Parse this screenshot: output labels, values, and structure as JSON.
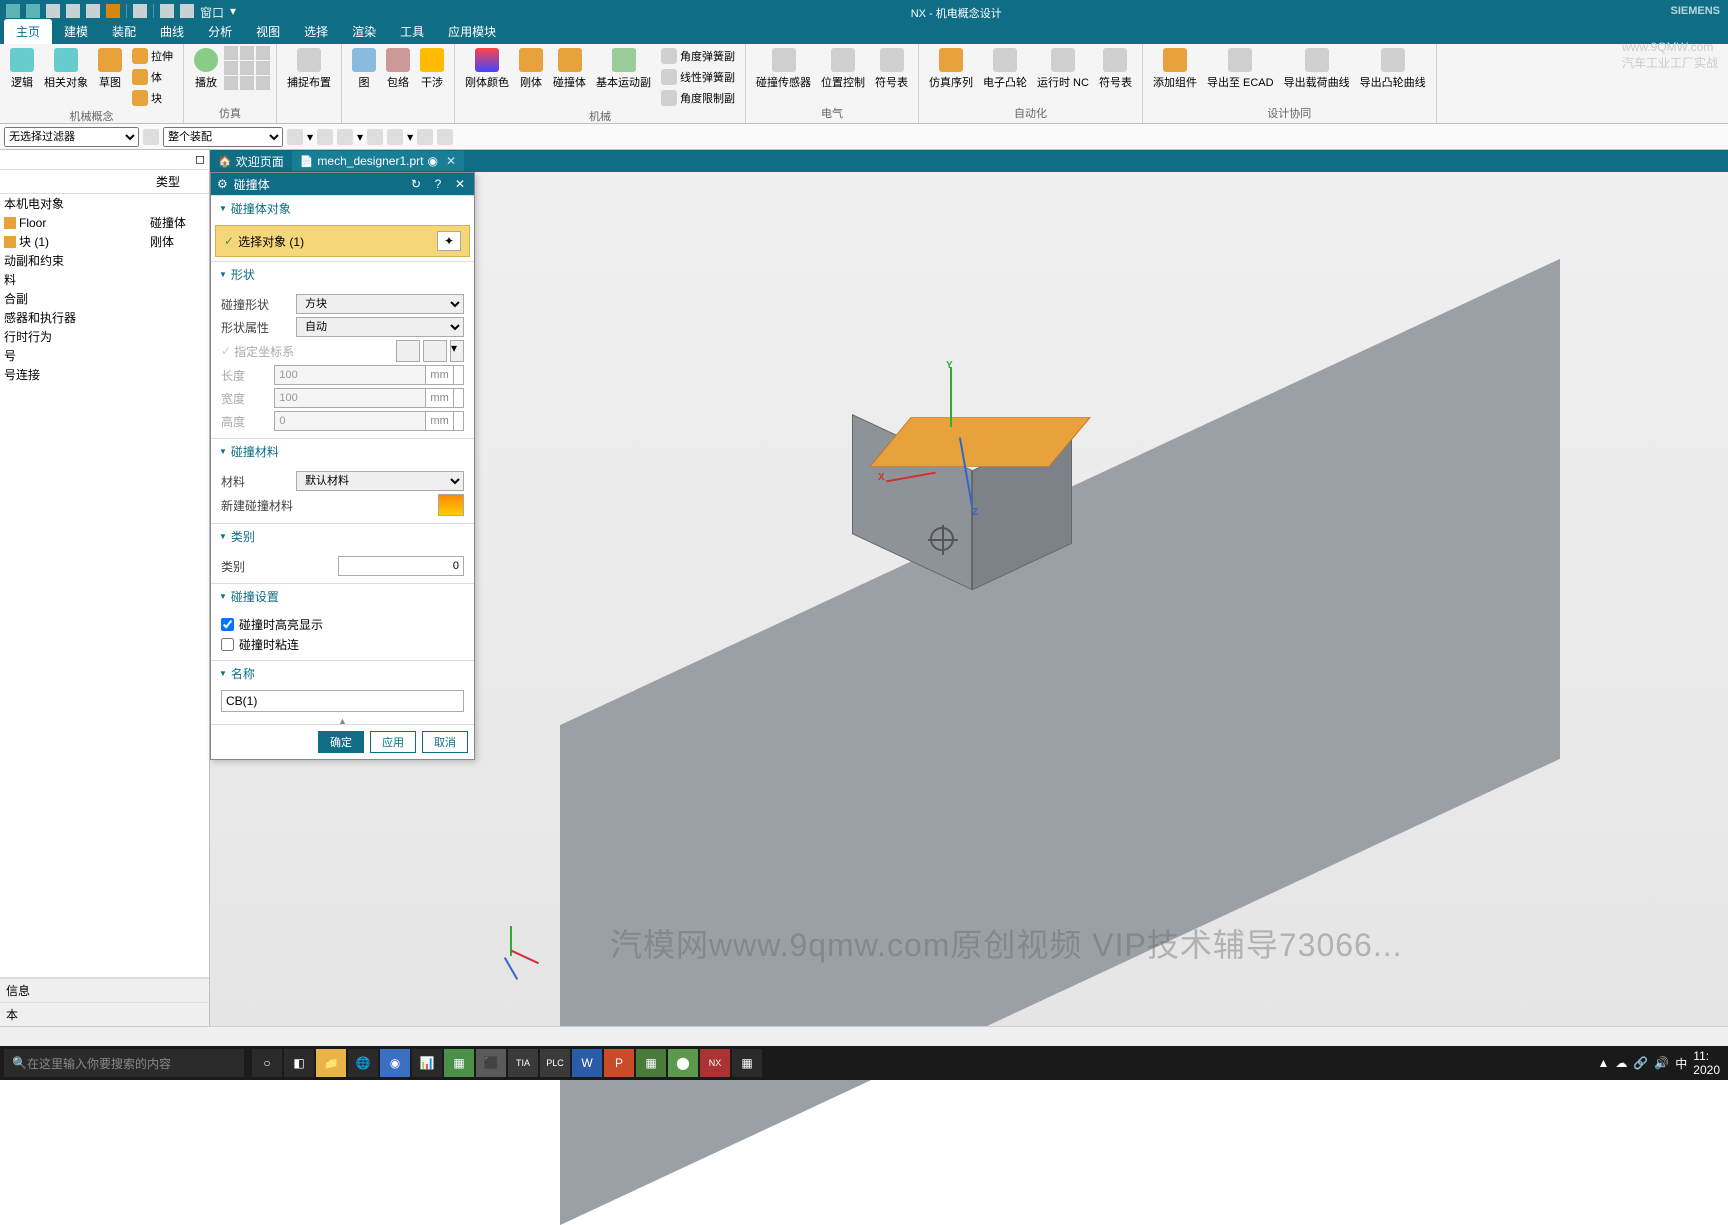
{
  "app_title": "NX - 机电概念设计",
  "brand": "SIEMENS",
  "watermark_url": "www.9QMW.com",
  "watermark_text": "汽车工业工厂实战",
  "footer_watermark": "汽模网www.9qmw.com原创视频 VIP技术辅导73066...",
  "menu": {
    "tabs": [
      "主页",
      "建模",
      "装配",
      "曲线",
      "分析",
      "视图",
      "选择",
      "渲染",
      "工具",
      "应用模块"
    ],
    "active": 0
  },
  "quick_access": {
    "window_label": "窗口"
  },
  "ribbon_groups": [
    {
      "name": "机械概念",
      "buttons": [
        "逻辑",
        "相关对象",
        "草图",
        ""
      ],
      "stack": [
        "拉伸",
        "体",
        "块"
      ]
    },
    {
      "name": "仿真",
      "buttons": [
        "播放"
      ],
      "small": [
        "",
        "",
        "",
        "",
        "",
        ""
      ]
    },
    {
      "name": "",
      "buttons": [
        "捕捉布置"
      ]
    },
    {
      "name": "",
      "buttons": [
        "图",
        "包络",
        "干涉"
      ]
    },
    {
      "name": "机械",
      "buttons": [
        "刚体颜色",
        "刚体",
        "碰撞体",
        "基本运动副"
      ],
      "stack": [
        "角度弹簧副",
        "线性弹簧副",
        "角度限制副"
      ]
    },
    {
      "name": "电气",
      "buttons": [
        "碰撞传感器",
        "位置控制",
        "符号表"
      ]
    },
    {
      "name": "自动化",
      "buttons": [
        "仿真序列",
        "电子凸轮",
        "运行时 NC",
        "符号表"
      ]
    },
    {
      "name": "设计协同",
      "buttons": [
        "添加组件",
        "导出至 ECAD",
        "导出载荷曲线",
        "导出凸轮曲线"
      ]
    }
  ],
  "filter": {
    "none": "无选择过滤器",
    "assembly": "整个装配"
  },
  "file_tabs": {
    "welcome": "欢迎页面",
    "file": "mech_designer1.prt"
  },
  "tree": {
    "cols": [
      "",
      "类型"
    ],
    "rows": [
      {
        "name": "本机电对象",
        "type": ""
      },
      {
        "name": "Floor",
        "type": "碰撞体",
        "icon": "org"
      },
      {
        "name": "块 (1)",
        "type": "刚体",
        "icon": "org"
      },
      {
        "name": "动副和约束",
        "type": ""
      },
      {
        "name": "料",
        "type": ""
      },
      {
        "name": "合副",
        "type": ""
      },
      {
        "name": "感器和执行器",
        "type": ""
      },
      {
        "name": "行时行为",
        "type": ""
      },
      {
        "name": "号",
        "type": ""
      },
      {
        "name": "号连接",
        "type": ""
      }
    ],
    "footer": [
      "信息",
      "本"
    ]
  },
  "dialog": {
    "title": "碰撞体",
    "sections": {
      "objects": {
        "title": "碰撞体对象",
        "select_label": "选择对象 (1)"
      },
      "shape": {
        "title": "形状",
        "shape_label": "碰撞形状",
        "shape_value": "方块",
        "attr_label": "形状属性",
        "attr_value": "自动",
        "cs_label": "指定坐标系",
        "len_label": "长度",
        "len_value": "100",
        "wid_label": "宽度",
        "wid_value": "100",
        "hei_label": "高度",
        "hei_value": "0",
        "unit": "mm"
      },
      "material": {
        "title": "碰撞材料",
        "mat_label": "材料",
        "mat_value": "默认材料",
        "new_label": "新建碰撞材料"
      },
      "category": {
        "title": "类别",
        "cat_label": "类别",
        "cat_value": "0"
      },
      "settings": {
        "title": "碰撞设置",
        "highlight": "碰撞时高亮显示",
        "stick": "碰撞时粘连"
      },
      "name": {
        "title": "名称",
        "value": "CB(1)"
      }
    },
    "buttons": {
      "ok": "确定",
      "apply": "应用",
      "cancel": "取消"
    }
  },
  "axes": {
    "x": "X",
    "y": "Y",
    "z": "Z"
  },
  "taskbar": {
    "search_placeholder": "在这里输入你要搜索的内容",
    "ime": "中",
    "time": "11:",
    "date": "2020"
  },
  "statusbar": ""
}
